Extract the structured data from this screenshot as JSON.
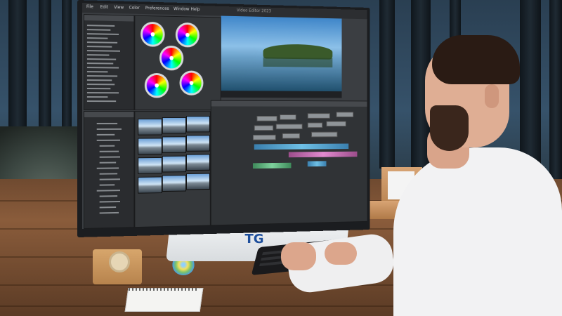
{
  "screen": {
    "menu": [
      "File",
      "Edit",
      "View",
      "Color",
      "Preferences",
      "Window",
      "Help"
    ],
    "window_title": "Video Editor 2023"
  },
  "monitor": {
    "logo": "TG"
  },
  "colors": {
    "sky": "#3f86c9",
    "desk_wood": "#8a5c3b",
    "shirt": "#f2f2f3",
    "screen_bg": "#3b3e42",
    "logo_blue": "#1e4f9c"
  }
}
